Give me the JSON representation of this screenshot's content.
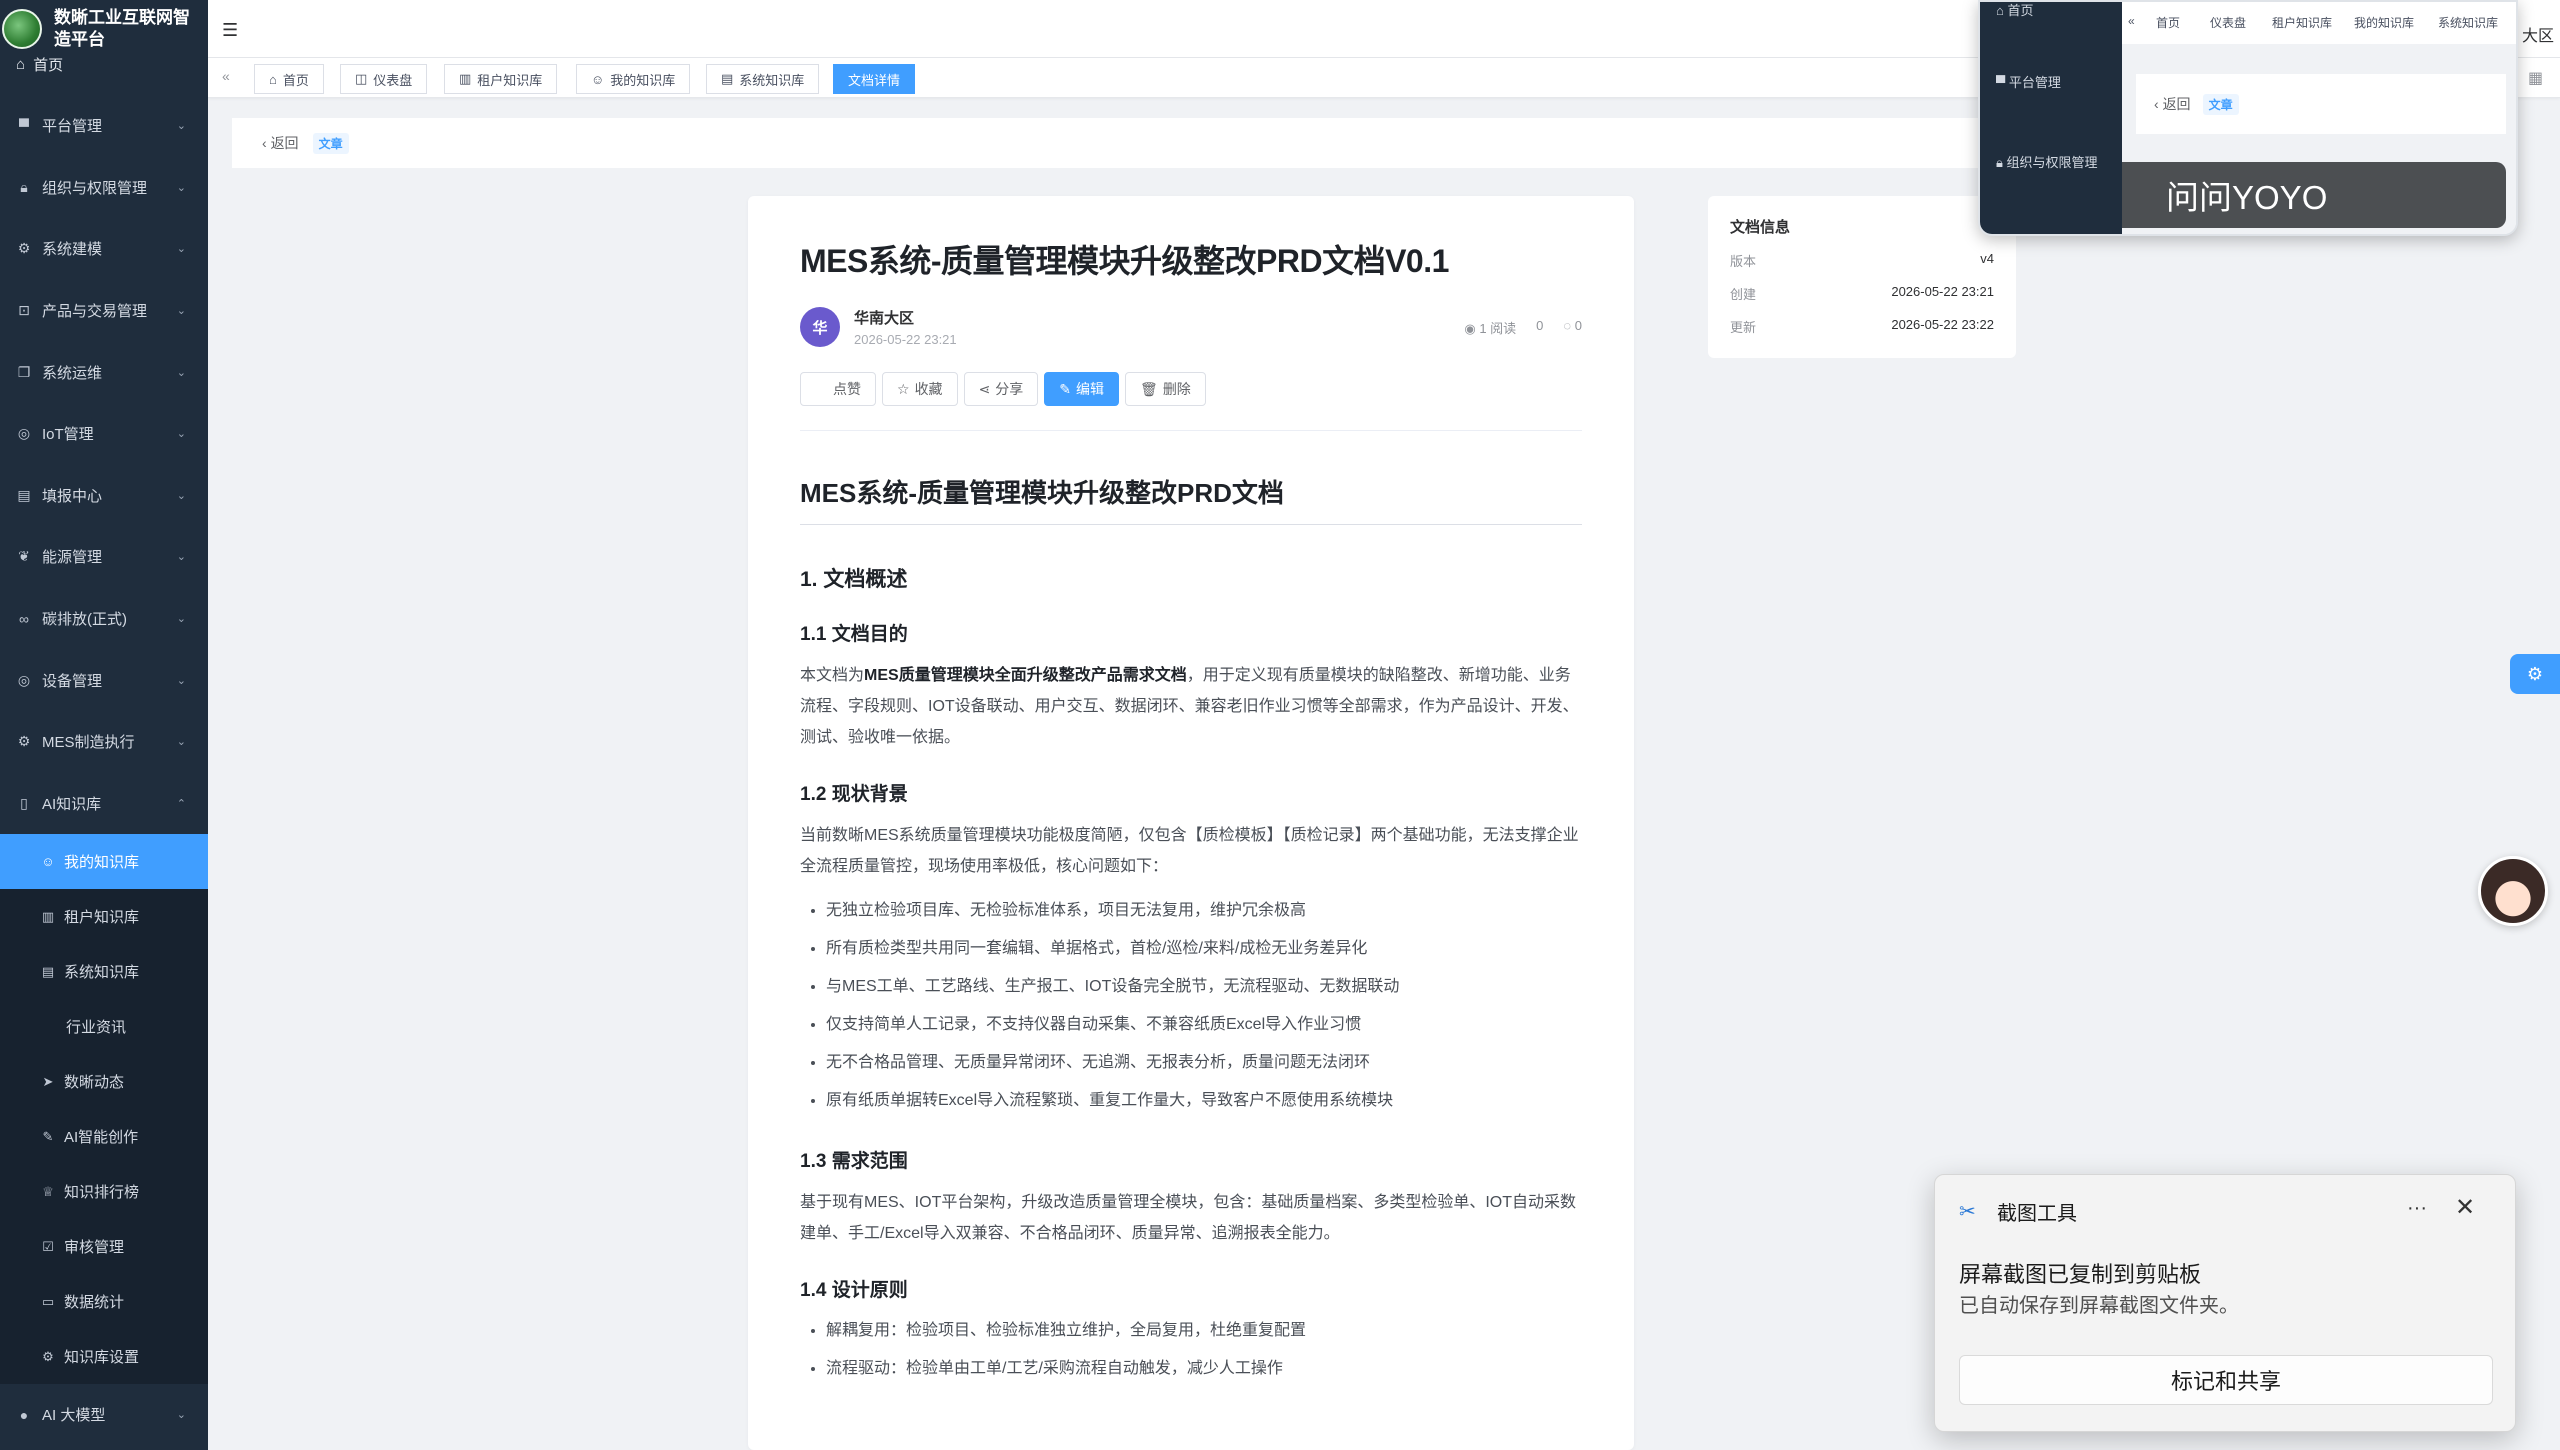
{
  "app": {
    "brand_title": "数晰工业互联网智造平台",
    "brand_home": "首页"
  },
  "sidebar": {
    "items": [
      {
        "label": "平台管理",
        "icon": "monitor-icon"
      },
      {
        "label": "组织与权限管理",
        "icon": "lock-icon"
      },
      {
        "label": "系统建模",
        "icon": "gear-icon"
      },
      {
        "label": "产品与交易管理",
        "icon": "cart-icon"
      },
      {
        "label": "系统运维",
        "icon": "copy-icon"
      },
      {
        "label": "IoT管理",
        "icon": "chip-icon"
      },
      {
        "label": "填报中心",
        "icon": "document-icon"
      },
      {
        "label": "能源管理",
        "icon": "leaf-icon"
      },
      {
        "label": "碳排放(正式)",
        "icon": "bike-icon"
      },
      {
        "label": "设备管理",
        "icon": "device-icon"
      },
      {
        "label": "MES制造执行",
        "icon": "gear-icon"
      },
      {
        "label": "AI知识库",
        "icon": "book-icon"
      }
    ],
    "sub_items": [
      {
        "label": "我的知识库",
        "icon": "user-icon"
      },
      {
        "label": "租户知识库",
        "icon": "building-icon"
      },
      {
        "label": "系统知识库",
        "icon": "document-icon"
      },
      {
        "label": "行业资讯",
        "icon": ""
      },
      {
        "label": "数晰动态",
        "icon": "send-icon"
      },
      {
        "label": "AI智能创作",
        "icon": "ai-icon"
      },
      {
        "label": "知识排行榜",
        "icon": "trophy-icon"
      },
      {
        "label": "审核管理",
        "icon": "audit-icon"
      },
      {
        "label": "数据统计",
        "icon": "chart-icon"
      },
      {
        "label": "知识库设置",
        "icon": "gear-icon"
      }
    ],
    "bottom_item": {
      "label": "AI 大模型",
      "icon": "apple-icon"
    }
  },
  "tabs": [
    {
      "label": "首页",
      "icon": "home-icon"
    },
    {
      "label": "仪表盘",
      "icon": "dashboard-icon"
    },
    {
      "label": "租户知识库",
      "icon": "building-icon"
    },
    {
      "label": "我的知识库",
      "icon": "user-icon"
    },
    {
      "label": "系统知识库",
      "icon": "document-icon"
    },
    {
      "label": "文档详情",
      "icon": ""
    }
  ],
  "subhead": {
    "back_label": "返回",
    "type_badge": "文章"
  },
  "doc": {
    "title": "MES系统-质量管理模块升级整改PRD文档V0.1",
    "author_initial": "华",
    "author_name": "华南大区",
    "author_date": "2026-05-22 23:21",
    "reads": "1 阅读",
    "likes": "0",
    "comments": "0",
    "actions": {
      "like": "点赞",
      "favorite": "收藏",
      "share": "分享",
      "edit": "编辑",
      "delete": "删除"
    },
    "h1": "MES系统-质量管理模块升级整改PRD文档",
    "s1_title": "1. 文档概述",
    "s11_title": "1.1 文档目的",
    "s11_pre": "本文档为",
    "s11_bold": "MES质量管理模块全面升级整改产品需求文档",
    "s11_post": "，用于定义现有质量模块的缺陷整改、新增功能、业务流程、字段规则、IOT设备联动、用户交互、数据闭环、兼容老旧作业习惯等全部需求，作为产品设计、开发、测试、验收唯一依据。",
    "s12_title": "1.2 现状背景",
    "s12_para": "当前数晰MES系统质量管理模块功能极度简陋，仅包含【质检模板】【质检记录】两个基础功能，无法支撑企业全流程质量管控，现场使用率极低，核心问题如下：",
    "s12_bullets": [
      "无独立检验项目库、无检验标准体系，项目无法复用，维护冗余极高",
      "所有质检类型共用同一套编辑、单据格式，首检/巡检/来料/成检无业务差异化",
      "与MES工单、工艺路线、生产报工、IOT设备完全脱节，无流程驱动、无数据联动",
      "仅支持简单人工记录，不支持仪器自动采集、不兼容纸质Excel导入作业习惯",
      "无不合格品管理、无质量异常闭环、无追溯、无报表分析，质量问题无法闭环",
      "原有纸质单据转Excel导入流程繁琐、重复工作量大，导致客户不愿使用系统模块"
    ],
    "s13_title": "1.3 需求范围",
    "s13_para": "基于现有MES、IOT平台架构，升级改造质量管理全模块，包含：基础质量档案、多类型检验单、IOT自动采数建单、手工/Excel导入双兼容、不合格品闭环、质量异常、追溯报表全能力。",
    "s14_title": "1.4 设计原则",
    "s14_bullets": [
      "解耦复用：检验项目、检验标准独立维护，全局复用，杜绝重复配置",
      "流程驱动：检验单由工单/工艺/采购流程自动触发，减少人工操作"
    ]
  },
  "info": {
    "title": "文档信息",
    "rows": [
      {
        "k": "版本",
        "v": "v4"
      },
      {
        "k": "创建",
        "v": "2026-05-22 23:21"
      },
      {
        "k": "更新",
        "v": "2026-05-22 23:22"
      }
    ]
  },
  "overlay": {
    "side_home": "首页",
    "side_platform": "平台管理",
    "side_org": "组织与权限管理",
    "tabs": [
      "首页",
      "仪表盘",
      "租户知识库",
      "我的知识库",
      "系统知识库"
    ],
    "back": "返回",
    "badge": "文章",
    "bubble": "问问YOYO"
  },
  "region_label": "大区",
  "toast": {
    "title": "截图工具",
    "line1": "屏幕截图已复制到剪贴板",
    "line2": "已自动保存到屏幕截图文件夹。",
    "button": "标记和共享"
  },
  "colors": {
    "accent": "#409eff",
    "sidebar_bg": "#1f2d3d"
  }
}
